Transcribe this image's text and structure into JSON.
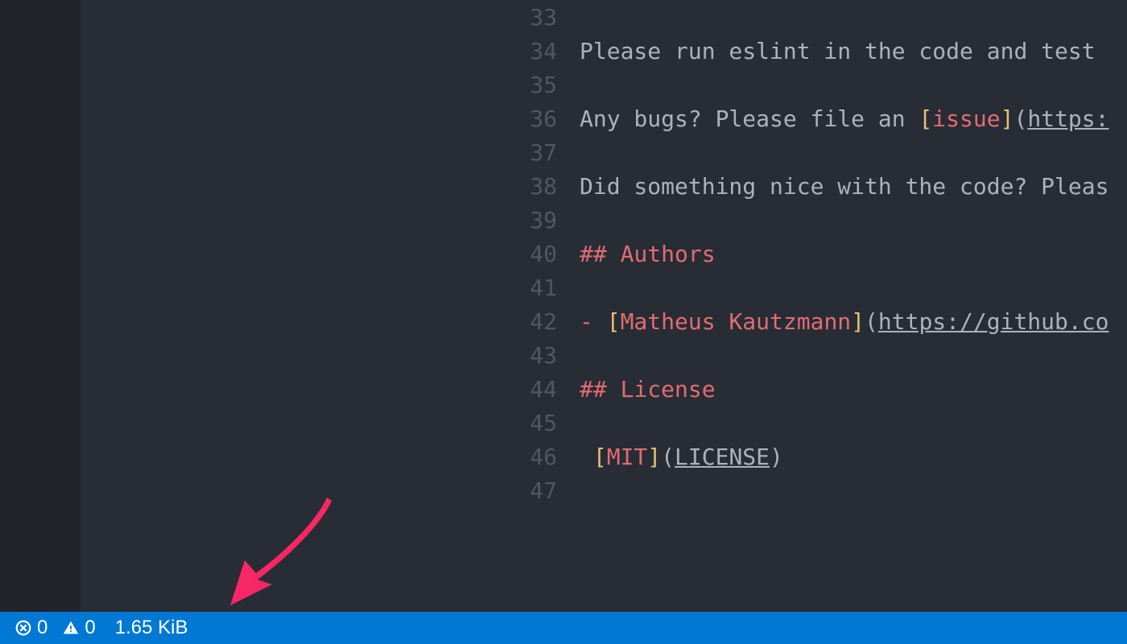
{
  "editor": {
    "lines": [
      {
        "n": "33",
        "segments": []
      },
      {
        "n": "34",
        "segments": [
          {
            "cls": "pl",
            "t": "Please run eslint in the code and test "
          }
        ]
      },
      {
        "n": "35",
        "segments": []
      },
      {
        "n": "36",
        "segments": [
          {
            "cls": "pl",
            "t": "Any bugs? Please file an "
          },
          {
            "cls": "br",
            "t": "["
          },
          {
            "cls": "lk",
            "t": "issue"
          },
          {
            "cls": "br",
            "t": "]"
          },
          {
            "cls": "pn",
            "t": "("
          },
          {
            "cls": "ul",
            "t": "https:"
          }
        ]
      },
      {
        "n": "37",
        "segments": []
      },
      {
        "n": "38",
        "segments": [
          {
            "cls": "pl",
            "t": "Did something nice with the code? Pleas"
          }
        ]
      },
      {
        "n": "39",
        "segments": []
      },
      {
        "n": "40",
        "segments": [
          {
            "cls": "hd",
            "t": "## Authors"
          }
        ]
      },
      {
        "n": "41",
        "segments": []
      },
      {
        "n": "42",
        "segments": [
          {
            "cls": "bl",
            "t": "- "
          },
          {
            "cls": "br",
            "t": "["
          },
          {
            "cls": "lk",
            "t": "Matheus Kautzmann"
          },
          {
            "cls": "br",
            "t": "]"
          },
          {
            "cls": "pn",
            "t": "("
          },
          {
            "cls": "ul",
            "t": "https://github.co"
          }
        ]
      },
      {
        "n": "43",
        "segments": []
      },
      {
        "n": "44",
        "segments": [
          {
            "cls": "hd",
            "t": "## License"
          }
        ]
      },
      {
        "n": "45",
        "segments": []
      },
      {
        "n": "46",
        "segments": [
          {
            "cls": "pl",
            "t": " "
          },
          {
            "cls": "br",
            "t": "["
          },
          {
            "cls": "lk",
            "t": "MIT"
          },
          {
            "cls": "br",
            "t": "]"
          },
          {
            "cls": "pn",
            "t": "("
          },
          {
            "cls": "ul",
            "t": "LICENSE"
          },
          {
            "cls": "pn",
            "t": ")"
          }
        ]
      },
      {
        "n": "47",
        "segments": []
      }
    ]
  },
  "status": {
    "errors": "0",
    "warnings": "0",
    "filesize": "1.65 KiB"
  }
}
